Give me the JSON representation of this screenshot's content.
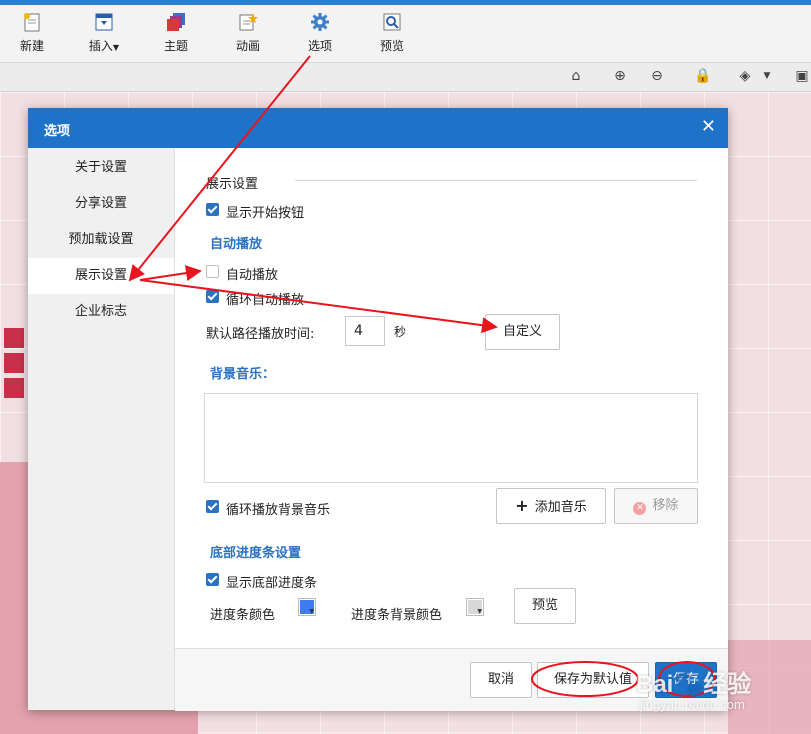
{
  "toolbar": {
    "items": [
      {
        "label": "新建",
        "icon": "new-document-icon"
      },
      {
        "label": "插入",
        "icon": "insert-window-icon"
      },
      {
        "label": "主题",
        "icon": "theme-stack-icon"
      },
      {
        "label": "动画",
        "icon": "animation-star-icon"
      },
      {
        "label": "选项",
        "icon": "gear-icon"
      },
      {
        "label": "预览",
        "icon": "magnifier-icon"
      }
    ]
  },
  "dialog": {
    "title": "选项",
    "close_symbol": "✕",
    "sidebar": {
      "items": [
        {
          "label": "关于设置",
          "active": false
        },
        {
          "label": "分享设置",
          "active": false
        },
        {
          "label": "预加载设置",
          "active": false
        },
        {
          "label": "展示设置",
          "active": true
        },
        {
          "label": "企业标志",
          "active": false
        }
      ]
    },
    "display": {
      "header": "展示设置",
      "show_start_button": {
        "label": "显示开始按钮",
        "checked": true
      },
      "autoplay_section": "自动播放",
      "autoplay": {
        "label": "自动播放",
        "checked": false
      },
      "loop_autoplay": {
        "label": "循环自动播放",
        "checked": true
      },
      "path_time_label": "默认路径播放时间:",
      "path_time_value": "4",
      "path_time_unit": "秒",
      "custom_button": "自定义",
      "music_section": "背景音乐：",
      "loop_music": {
        "label": "循环播放背景音乐",
        "checked": true
      },
      "add_music_button": "添加音乐",
      "remove_button": "移除",
      "progress_section": "底部进度条设置",
      "show_progress": {
        "label": "显示底部进度条",
        "checked": true
      },
      "progress_color_label": "进度条颜色",
      "progress_bg_color_label": "进度条背景颜色",
      "preview_button": "预览"
    },
    "footer": {
      "cancel": "取消",
      "save_default": "保存为默认值",
      "save": "保存"
    }
  },
  "watermark": {
    "brand": "Bai",
    "brand_cn": "经验",
    "url": "jingyan.baidu.com"
  },
  "colors": {
    "accent": "#1e73c9",
    "checkbox": "#2a73c0",
    "progress_color": "#3d7df0",
    "progress_bg_color": "#d8d8d8",
    "annotation": "#e8141e"
  }
}
